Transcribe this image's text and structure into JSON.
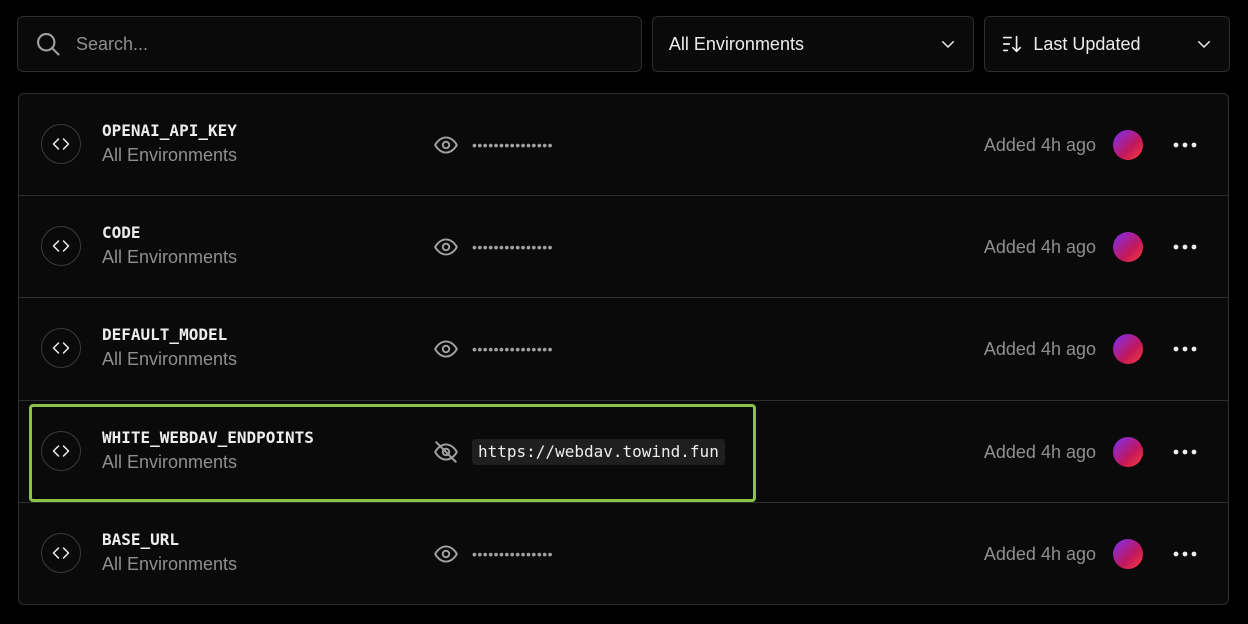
{
  "search": {
    "placeholder": "Search..."
  },
  "filters": {
    "environment": "All Environments",
    "sort": "Last Updated"
  },
  "rows": [
    {
      "key": "OPENAI_API_KEY",
      "environment": "All Environments",
      "masked": "•••••••••••••••",
      "added": "Added 4h ago"
    },
    {
      "key": "CODE",
      "environment": "All Environments",
      "masked": "•••••••••••••••",
      "added": "Added 4h ago"
    },
    {
      "key": "DEFAULT_MODEL",
      "environment": "All Environments",
      "masked": "•••••••••••••••",
      "added": "Added 4h ago"
    },
    {
      "key": "WHITE_WEBDAV_ENDPOINTS",
      "environment": "All Environments",
      "value": "https://webdav.towind.fun",
      "added": "Added 4h ago",
      "revealed": true,
      "highlighted": true
    },
    {
      "key": "BASE_URL",
      "environment": "All Environments",
      "masked": "•••••••••••••••",
      "added": "Added 4h ago"
    }
  ],
  "colors": {
    "highlight": "#8bc34a",
    "background": "#000000",
    "panel": "#0a0a0a",
    "border": "#2e2e2e"
  },
  "icons": [
    "search-icon",
    "chevron-down-icon",
    "sort-icon",
    "code-icon",
    "eye-icon",
    "eye-off-icon",
    "more-icon"
  ]
}
